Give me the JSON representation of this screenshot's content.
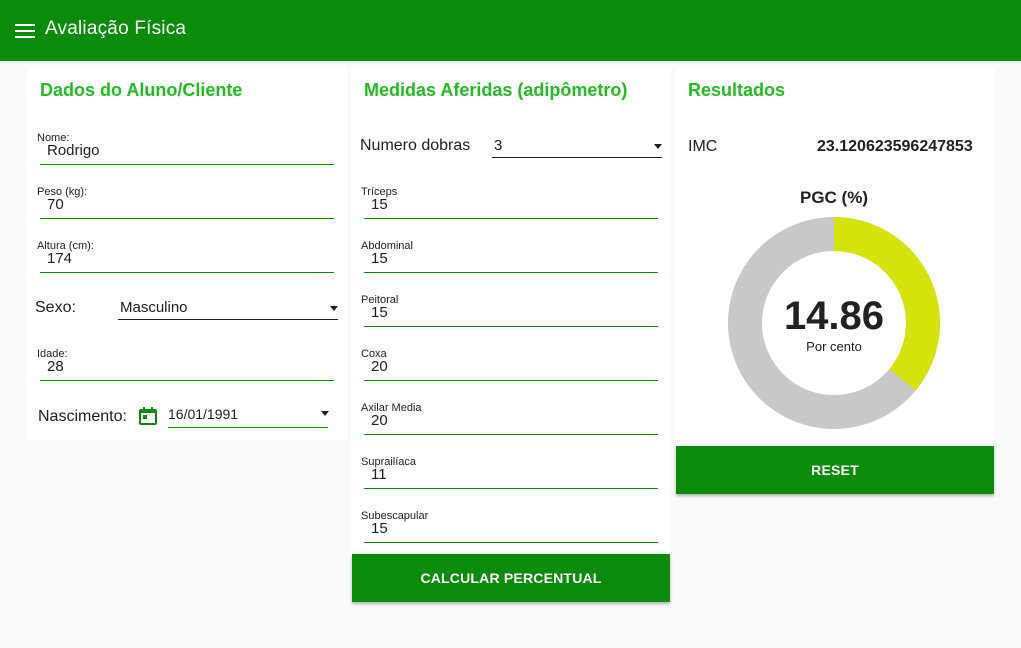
{
  "app": {
    "title": "Avaliação Física",
    "accent": "#0b8a0b",
    "title_color": "#22bb22"
  },
  "student": {
    "title": "Dados do Aluno/Cliente",
    "nome": {
      "label": "Nome:",
      "value": "Rodrigo"
    },
    "peso": {
      "label": "Peso (kg):",
      "value": "70"
    },
    "altura": {
      "label": "Altura (cm):",
      "value": "174"
    },
    "sexo": {
      "label": "Sexo:",
      "value": "Masculino"
    },
    "idade": {
      "label": "Idade:",
      "value": "28"
    },
    "nascimento": {
      "label": "Nascimento:",
      "value": "16/01/1991"
    }
  },
  "measures": {
    "title": "Medidas Aferidas (adipômetro)",
    "dobras": {
      "label": "Numero dobras",
      "value": "3"
    },
    "fields": [
      {
        "label": "Tríceps",
        "value": "15"
      },
      {
        "label": "Abdominal",
        "value": "15"
      },
      {
        "label": "Peitoral",
        "value": "15"
      },
      {
        "label": "Coxa",
        "value": "20"
      },
      {
        "label": "Axilar Media",
        "value": "20"
      },
      {
        "label": "Suprailíaca",
        "value": "11"
      },
      {
        "label": "Subescapular",
        "value": "15"
      }
    ],
    "button_label": "CALCULAR PERCENTUAL"
  },
  "results": {
    "title": "Resultados",
    "imc": {
      "label": "IMC",
      "value": "23.120623596247853"
    },
    "pgc": {
      "title": "PGC (%)",
      "value": "14.86",
      "unit": "Por cento",
      "fill_fraction": 0.36,
      "fill_color": "#d4e30a",
      "track_color": "#c8c8c8"
    },
    "reset_label": "RESET"
  }
}
